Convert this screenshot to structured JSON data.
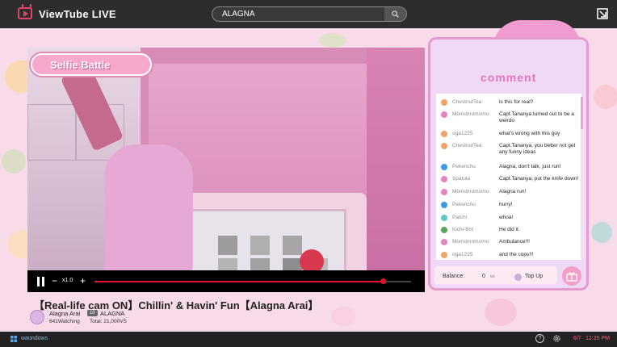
{
  "app": {
    "title": "ViewTube  LIVE"
  },
  "search": {
    "value": "ALAGNA"
  },
  "overlay": {
    "badge": "Selfie Battle"
  },
  "player": {
    "speed": "x1.0",
    "progress": 0.91
  },
  "stream": {
    "title": "【Real-life cam ON】Chillin' & Havin' Fun【Alagna Arai】",
    "streamer": "Alagna Arai",
    "level": "10",
    "group": "ALAGNA",
    "watching": "641Watching",
    "total": "Total: 21,000VS"
  },
  "chat": {
    "heading": "comment",
    "messages": [
      {
        "user": "ChestnutTea",
        "text": "is this for real?",
        "color": "#f0a46a"
      },
      {
        "user": "Momomomomo",
        "text": "Capt.Tananya turned out to be a weirdo",
        "color": "#e384c4"
      },
      {
        "user": "oga1225",
        "text": "what's wrong with this guy",
        "color": "#f0a46a"
      },
      {
        "user": "ChestnutTea",
        "text": "Capt.Tananya, you better not get any funny ideas",
        "color": "#f0a46a"
      },
      {
        "user": "Pekenchu",
        "text": "Alagna, don't talk, just run!",
        "color": "#3a9be0"
      },
      {
        "user": "Spatula",
        "text": "Capt.Tananya, put the knife down!",
        "color": "#e384c4"
      },
      {
        "user": "Momomomomo",
        "text": "Alagna run!",
        "color": "#e384c4"
      },
      {
        "user": "Pekenchu",
        "text": "hurry!",
        "color": "#3a9be0"
      },
      {
        "user": "Patchi",
        "text": "whoa!",
        "color": "#5dc8c8"
      },
      {
        "user": "Kichi-Bro",
        "text": "He did it.",
        "color": "#5aa55a"
      },
      {
        "user": "Momomomomo",
        "text": "Ambulance!!!",
        "color": "#e384c4"
      },
      {
        "user": "oga1225",
        "text": "and the cops!!!",
        "color": "#f0a46a"
      }
    ],
    "balance_label": "Balance:",
    "balance_value": "0",
    "balance_unit": "vs",
    "topup_label": "Top Up"
  },
  "taskbar": {
    "os_name": "waondows",
    "date": "6/7",
    "time": "12:35 PM"
  }
}
